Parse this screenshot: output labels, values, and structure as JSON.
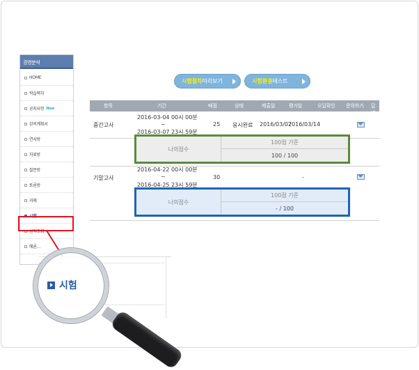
{
  "sidebar": {
    "title": "경영분석",
    "items": [
      {
        "label": "HOME",
        "new": ""
      },
      {
        "label": "학습목차",
        "new": ""
      },
      {
        "label": "공지사항",
        "new": "New"
      },
      {
        "label": "강의계획서",
        "new": ""
      },
      {
        "label": "연사방",
        "new": ""
      },
      {
        "label": "자료방",
        "new": ""
      },
      {
        "label": "질문방",
        "new": ""
      },
      {
        "label": "토론방",
        "new": ""
      },
      {
        "label": "과제",
        "new": ""
      },
      {
        "label": "시험",
        "new": ""
      },
      {
        "label": "성적조회",
        "new": ""
      },
      {
        "label": "매론…",
        "new": ""
      }
    ]
  },
  "buttons": {
    "preview": {
      "highlight": "시험절차",
      "rest": " 미리보기"
    },
    "env_test": {
      "highlight": "시험환경",
      "rest": " 테스트"
    }
  },
  "table": {
    "headers": [
      "항목",
      "기간",
      "배점",
      "상태",
      "제출일",
      "평가일",
      "오답확인",
      "문의하기",
      "답변"
    ],
    "rows": [
      {
        "item": "중간고사",
        "start": "2016-03-04 00시 00분",
        "tilde": "~",
        "end": "2016-03-07 23시 59분",
        "points": "25",
        "status": "응시완료",
        "submitted": "2016/03/07",
        "evaluated": "2016/03/14",
        "wrong": "",
        "score_label": "나의점수",
        "score_basis": "100점 기준",
        "score_value": "100  / 100"
      },
      {
        "item": "기말고사",
        "start": "2016-04-22 00시 00분",
        "tilde": "~",
        "end": "2016-04-25 23시 59분",
        "points": "30",
        "status": "",
        "submitted": "",
        "evaluated": "-",
        "wrong": "",
        "score_label": "나의점수",
        "score_basis": "100점 기준",
        "score_value": "- / 100"
      }
    ]
  },
  "zoom": {
    "label": "시험"
  },
  "colors": {
    "accent": "#2b5ba3",
    "highlight_red": "#e0141e",
    "green_box": "#5a8a3a",
    "blue_box": "#1c63b8",
    "button": "#7fb4dc"
  }
}
